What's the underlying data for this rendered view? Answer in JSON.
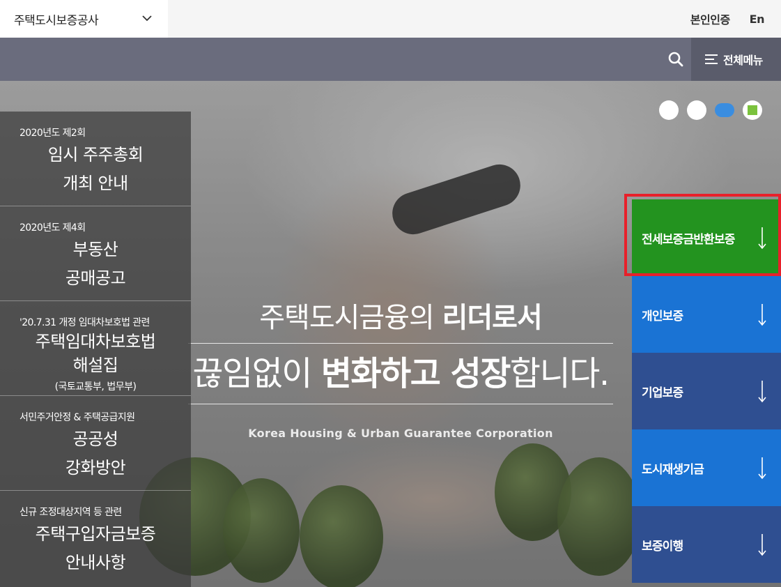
{
  "top_bar": {
    "org_select_value": "주택도시보증공사",
    "links": [
      "본인인증",
      "En"
    ]
  },
  "nav": {
    "search_icon": "search-icon",
    "all_menu_label": "전체메뉴"
  },
  "hero": {
    "slogan_line1_normal": "주택도시금융의 ",
    "slogan_line1_bold": "리더로서",
    "slogan_line2_a": "끊임없이 ",
    "slogan_line2_b": "변화하고 성장",
    "slogan_line2_c": "합니다.",
    "subtitle": "Korea Housing & Urban Guarantee Corporation"
  },
  "notices": [
    {
      "kicker": "2020년도 제2회",
      "title_lines": [
        "임시 주주총회",
        "개최 안내"
      ],
      "note": ""
    },
    {
      "kicker": "2020년도 제4회",
      "title_lines": [
        "부동산",
        "공매공고"
      ],
      "note": ""
    },
    {
      "kicker": "'20.7.31 개정 임대차보호법 관련",
      "title_lines": [
        "주택임대차보호법",
        "해설집"
      ],
      "note": "(국토교통부, 법무부)"
    },
    {
      "kicker": "서민주거안정 & 주택공급지원",
      "title_lines": [
        "공공성",
        "강화방안"
      ],
      "note": ""
    },
    {
      "kicker": "신규 조정대상지역 등 관련",
      "title_lines": [
        "주택구입자금보증",
        "안내사항"
      ],
      "note": ""
    }
  ],
  "quick_menu": [
    {
      "label": "전세보증금반환보증",
      "color": "#23931f"
    },
    {
      "label": "개인보증",
      "color": "#1a73d4"
    },
    {
      "label": "기업보증",
      "color": "#2f4f91"
    },
    {
      "label": "도시재생기금",
      "color": "#1a73d4"
    },
    {
      "label": "보증이행",
      "color": "#2f4f91"
    }
  ],
  "colors": {
    "nav_bg": "#6a6c7d",
    "highlight_border": "#e8202a",
    "dot_active": "#3a8de0",
    "pause_square": "#7bc23d"
  }
}
